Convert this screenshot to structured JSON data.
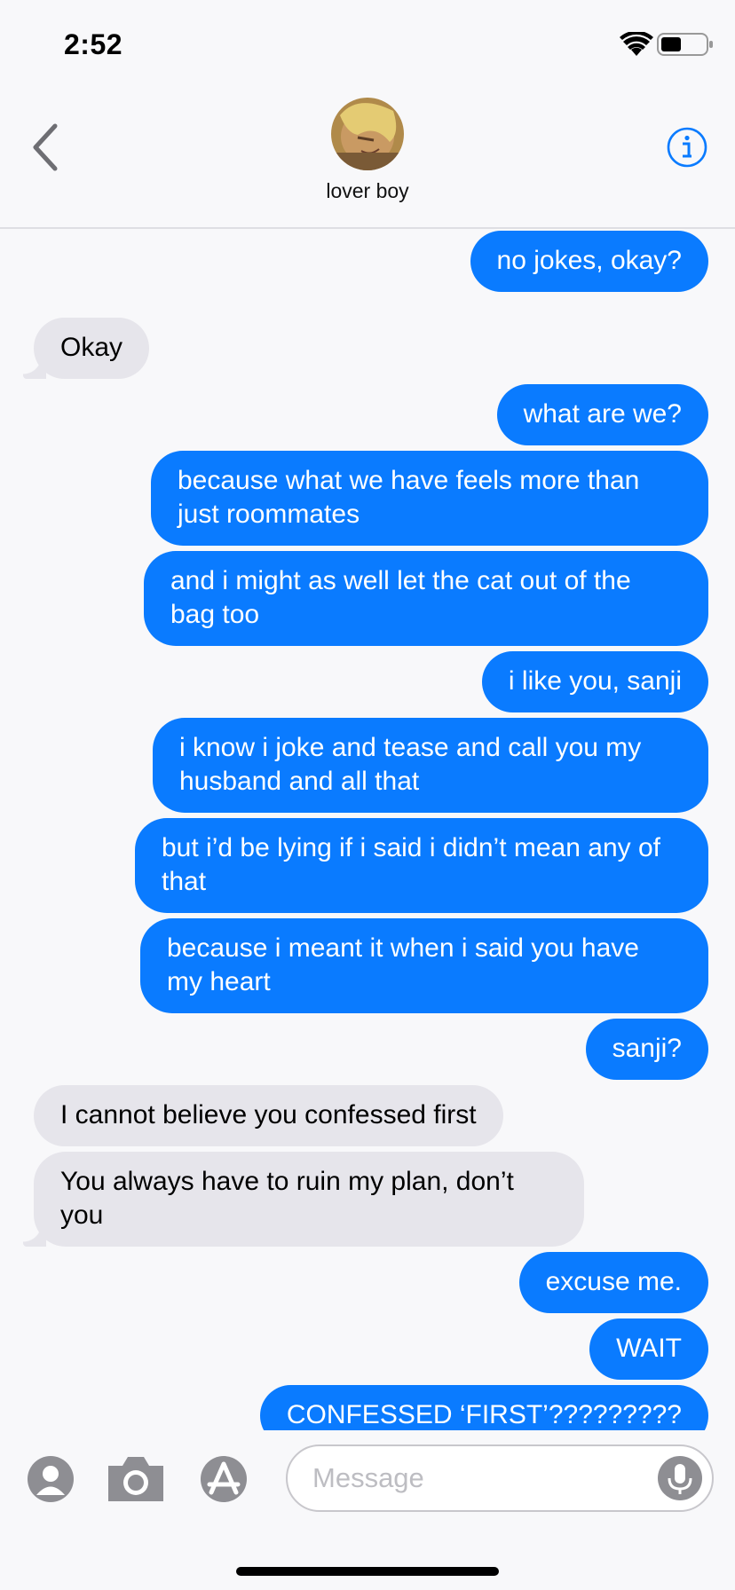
{
  "status_bar": {
    "time": "2:52",
    "icons": [
      "wifi-icon",
      "battery-icon"
    ]
  },
  "header": {
    "contact_name": "lover boy",
    "back_icon": "chevron-left-icon",
    "info_icon": "info-icon",
    "avatar": "contact-avatar"
  },
  "colors": {
    "outgoing_bubble": "#0a7bff",
    "incoming_bubble": "#e6e5eb",
    "accent": "#0a7bff",
    "background": "#f8f8fa"
  },
  "messages": [
    {
      "dir": "out",
      "text": "no jokes, okay?"
    },
    {
      "dir": "in",
      "text": "Okay"
    },
    {
      "dir": "out",
      "text": "what are we?"
    },
    {
      "dir": "out",
      "text": "because what we have feels more than just roommates"
    },
    {
      "dir": "out",
      "text": "and i might as well let the cat out of the bag too"
    },
    {
      "dir": "out",
      "text": "i like you, sanji"
    },
    {
      "dir": "out",
      "text": "i know i joke and tease and call you my husband and all that"
    },
    {
      "dir": "out",
      "text": "but i’d be lying if i said i didn’t mean any of that"
    },
    {
      "dir": "out",
      "text": "because i meant it when i said you have my heart"
    },
    {
      "dir": "out",
      "text": "sanji?"
    },
    {
      "dir": "in",
      "text": "I cannot believe you confessed first"
    },
    {
      "dir": "in",
      "text": "You always have to ruin my plan, don’t you"
    },
    {
      "dir": "out",
      "text": "excuse me."
    },
    {
      "dir": "out",
      "text": "WAIT"
    },
    {
      "dir": "out",
      "text": "CONFESSED ‘FIRST’?????????"
    }
  ],
  "compose": {
    "placeholder": "Message",
    "value": "",
    "left_icons": [
      "contacts-icon",
      "camera-icon",
      "app-store-icon"
    ],
    "mic_icon": "microphone-icon"
  }
}
